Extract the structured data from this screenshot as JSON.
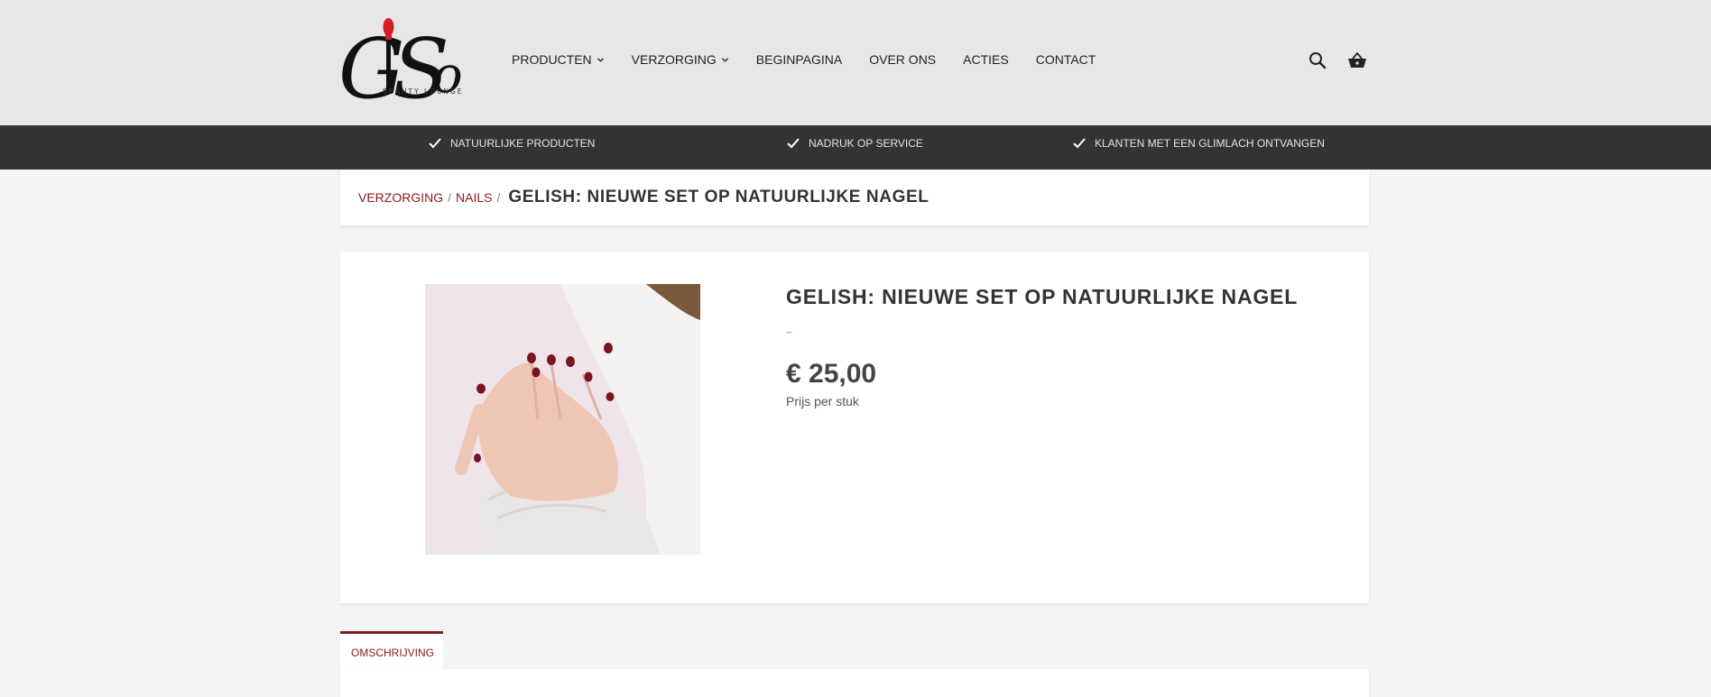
{
  "header": {
    "logo": {
      "text": "GiSo",
      "tagline": "BEAUTY LOUNGE",
      "accent": "#d32027"
    },
    "nav": [
      {
        "label": "PRODUCTEN",
        "dropdown": true
      },
      {
        "label": "VERZORGING",
        "dropdown": true
      },
      {
        "label": "BEGINPAGINA",
        "dropdown": false
      },
      {
        "label": "OVER ONS",
        "dropdown": false
      },
      {
        "label": "ACTIES",
        "dropdown": false
      },
      {
        "label": "CONTACT",
        "dropdown": false
      }
    ],
    "icons": [
      "search-icon",
      "basket-icon"
    ]
  },
  "usps": [
    {
      "icon": "check-icon",
      "label": "NATUURLIJKE PRODUCTEN"
    },
    {
      "icon": "check-icon",
      "label": "NADRUK OP SERVICE"
    },
    {
      "icon": "check-icon",
      "label": "KLANTEN MET EEN GLIMLACH ONTVANGEN"
    }
  ],
  "breadcrumb": {
    "items": [
      "VERZORGING",
      "NAILS"
    ],
    "separator": "/",
    "current": "GELISH: NIEUWE SET OP NATUURLIJKE NAGEL"
  },
  "product": {
    "title": "GELISH: NIEUWE SET OP NATUURLIJKE NAGEL",
    "dash": "_",
    "price": "€ 25,00",
    "unit": "Prijs per stuk"
  },
  "tabs": [
    {
      "label": "OMSCHRIJVING",
      "active": true
    }
  ],
  "colors": {
    "accent": "#8b1a1a",
    "header_bg": "#e7e7e7",
    "usp_bg": "#333333",
    "page_bg": "#f3f4f6"
  }
}
